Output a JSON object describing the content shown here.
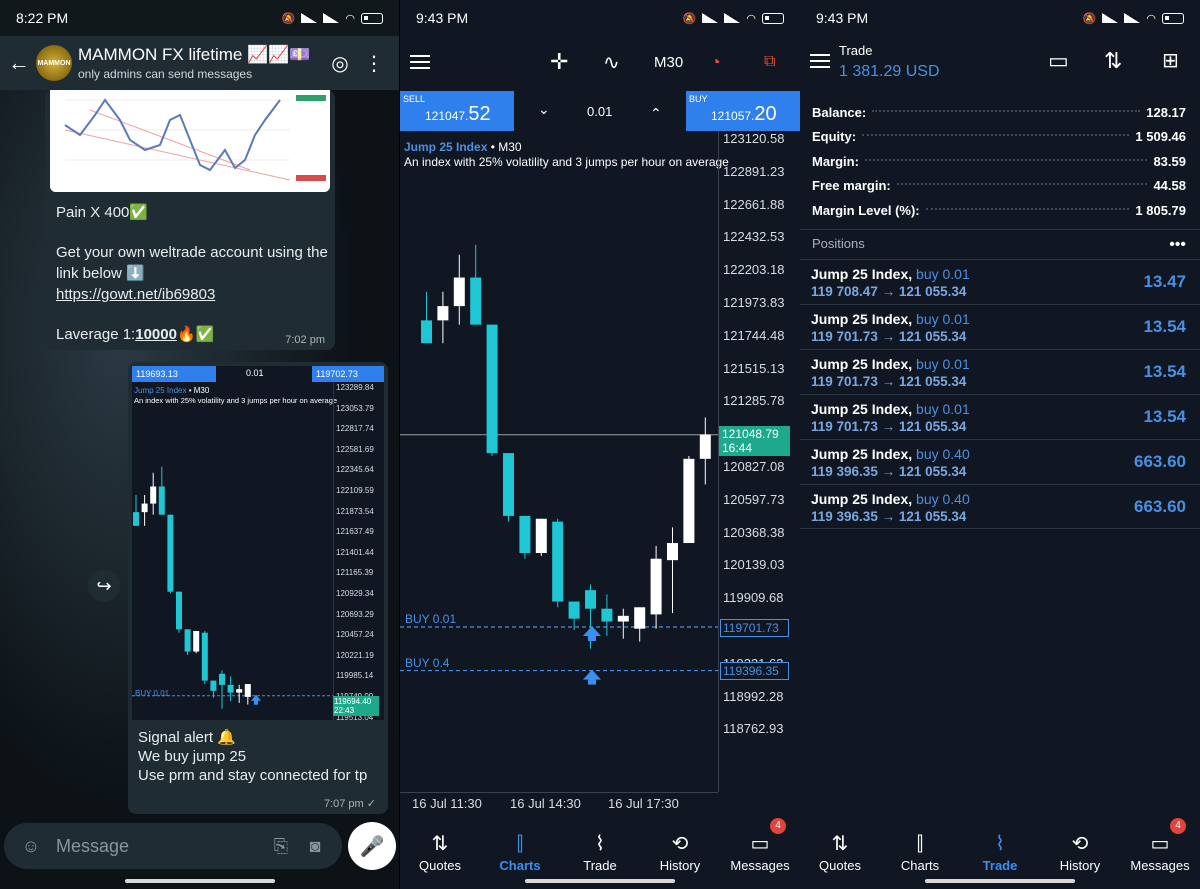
{
  "panel1": {
    "time": "8:22 PM",
    "header": {
      "title": "MAMMON FX lifetime 📈📈💷",
      "subtitle": "only admins can send messages",
      "logo_text": "MAMMON"
    },
    "msg1": {
      "line1": "Pain X 400✅",
      "line2": "Get your own weltrade account using the link below ⬇️",
      "link": "https://gowt.net/ib69803",
      "line3_prefix": "Laverage 1:",
      "line3_value": "10000",
      "line3_suffix": "🔥✅",
      "time": "7:02 pm"
    },
    "msg2": {
      "mini_chart": {
        "sell": "119693.13",
        "lot": "0.01",
        "buy": "119702.73",
        "symbol": "Jump 25 Index",
        "tf": "• M30",
        "desc": "An index with 25% volatility and 3 jumps per hour on average",
        "ticks": [
          "123289.84",
          "123053.79",
          "122817.74",
          "122581.69",
          "122345.64",
          "122109.59",
          "121873.54",
          "121637.49",
          "121401.44",
          "121165.39",
          "120929.34",
          "120693.29",
          "120457.24",
          "120221.19",
          "119985.14",
          "119749.09",
          "119513.04"
        ],
        "buy_label": "BUY 0.01",
        "current": "119694.40",
        "countdown": "22:43"
      },
      "line1": "Signal alert 🔔",
      "line2": "We buy jump 25",
      "line3": "Use prm and stay connected for tp",
      "time": "7:07 pm ✓"
    },
    "input_placeholder": "Message"
  },
  "panel2": {
    "time": "9:43 PM",
    "timeframe": "M30",
    "sell_label": "SELL",
    "sell_price_small": "121047.",
    "sell_price_big": "52",
    "lot": "0.01",
    "buy_label": "BUY",
    "buy_price_small": "121057.",
    "buy_price_big": "20",
    "symbol": "Jump 25 Index",
    "tf_label": "• M30",
    "description": "An index with 25% volatility and 3 jumps per hour on average",
    "price_ticks": [
      "123120.58",
      "122891.23",
      "122661.88",
      "122432.53",
      "122203.18",
      "121973.83",
      "121744.48",
      "121515.13",
      "121285.78",
      "120827.08",
      "120597.73",
      "120368.38",
      "120139.03",
      "119909.68",
      "119450.98",
      "119221.63",
      "118992.28",
      "118762.93"
    ],
    "current_price": "121048.79",
    "countdown": "16:44",
    "buy_line_1": {
      "label": "BUY 0.01",
      "price": "119701.73"
    },
    "buy_line_2": {
      "label": "BUY 0.4",
      "price": "119396.35"
    },
    "time_ticks": [
      "16 Jul 11:30",
      "16 Jul 14:30",
      "16 Jul 17:30"
    ],
    "nav": [
      {
        "label": "Quotes",
        "icon": "⇅"
      },
      {
        "label": "Charts",
        "icon": "⫿"
      },
      {
        "label": "Trade",
        "icon": "⌇"
      },
      {
        "label": "History",
        "icon": "⟲"
      },
      {
        "label": "Messages",
        "icon": "▭",
        "badge": "4"
      }
    ]
  },
  "panel3": {
    "time": "9:43 PM",
    "title": "Trade",
    "balance_header": "1 381.29 USD",
    "account": [
      {
        "label": "Balance:",
        "value": "128.17"
      },
      {
        "label": "Equity:",
        "value": "1 509.46"
      },
      {
        "label": "Margin:",
        "value": "83.59"
      },
      {
        "label": "Free margin:",
        "value": "44.58"
      },
      {
        "label": "Margin Level (%):",
        "value": "1 805.79"
      }
    ],
    "positions_title": "Positions",
    "positions": [
      {
        "symbol": "Jump 25 Index,",
        "dir": "buy 0.01",
        "open": "119 708.47",
        "arrow": "→",
        "current": "121 055.34",
        "pl": "13.47"
      },
      {
        "symbol": "Jump 25 Index,",
        "dir": "buy 0.01",
        "open": "119 701.73",
        "arrow": "→",
        "current": "121 055.34",
        "pl": "13.54"
      },
      {
        "symbol": "Jump 25 Index,",
        "dir": "buy 0.01",
        "open": "119 701.73",
        "arrow": "→",
        "current": "121 055.34",
        "pl": "13.54"
      },
      {
        "symbol": "Jump 25 Index,",
        "dir": "buy 0.01",
        "open": "119 701.73",
        "arrow": "→",
        "current": "121 055.34",
        "pl": "13.54"
      },
      {
        "symbol": "Jump 25 Index,",
        "dir": "buy 0.40",
        "open": "119 396.35",
        "arrow": "→",
        "current": "121 055.34",
        "pl": "663.60"
      },
      {
        "symbol": "Jump 25 Index,",
        "dir": "buy 0.40",
        "open": "119 396.35",
        "arrow": "→",
        "current": "121 055.34",
        "pl": "663.60"
      }
    ],
    "nav": [
      {
        "label": "Quotes",
        "icon": "⇅"
      },
      {
        "label": "Charts",
        "icon": "⫿"
      },
      {
        "label": "Trade",
        "icon": "⌇"
      },
      {
        "label": "History",
        "icon": "⟲"
      },
      {
        "label": "Messages",
        "icon": "▭",
        "badge": "4"
      }
    ]
  },
  "candles": [
    {
      "o": 121850,
      "h": 122050,
      "l": 121690,
      "c": 121690
    },
    {
      "o": 121850,
      "h": 122050,
      "l": 121690,
      "c": 121950
    },
    {
      "o": 121950,
      "h": 122310,
      "l": 121820,
      "c": 122150
    },
    {
      "o": 122150,
      "h": 122380,
      "l": 121890,
      "c": 121820
    },
    {
      "o": 121820,
      "h": 121820,
      "l": 120900,
      "c": 120920
    },
    {
      "o": 120920,
      "h": 120920,
      "l": 120440,
      "c": 120480
    },
    {
      "o": 120480,
      "h": 120480,
      "l": 120180,
      "c": 120220
    },
    {
      "o": 120220,
      "h": 120460,
      "l": 120200,
      "c": 120460
    },
    {
      "o": 120440,
      "h": 120460,
      "l": 119840,
      "c": 119880
    },
    {
      "o": 119880,
      "h": 119880,
      "l": 119680,
      "c": 119760
    },
    {
      "o": 119960,
      "h": 120000,
      "l": 119550,
      "c": 119830
    },
    {
      "o": 119830,
      "h": 119930,
      "l": 119640,
      "c": 119740
    },
    {
      "o": 119740,
      "h": 119830,
      "l": 119620,
      "c": 119780
    },
    {
      "o": 119690,
      "h": 119820,
      "l": 119600,
      "c": 119840
    },
    {
      "o": 119790,
      "h": 120270,
      "l": 119690,
      "c": 120180
    },
    {
      "o": 120170,
      "h": 120400,
      "l": 119800,
      "c": 120290
    },
    {
      "o": 120290,
      "h": 120900,
      "l": 120350,
      "c": 120880
    },
    {
      "o": 120880,
      "h": 121170,
      "l": 120700,
      "c": 121050
    }
  ]
}
